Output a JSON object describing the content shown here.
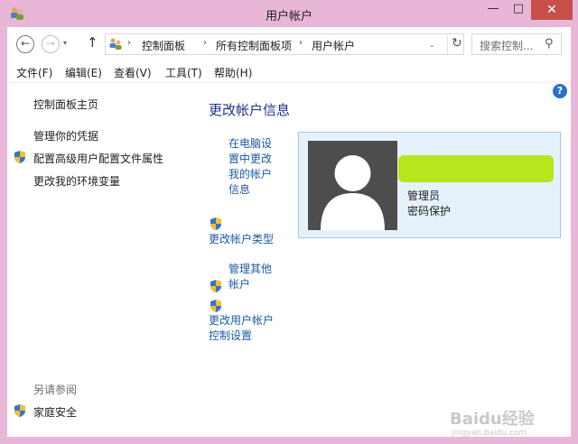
{
  "window": {
    "title": "用户帐户"
  },
  "title_buttons": {
    "minimize": "—",
    "maximize": "□",
    "close": "✕"
  },
  "nav": {
    "back": "←",
    "forward": "→",
    "recent": "▾",
    "up": "↑",
    "refresh": "↻",
    "dropdown": "⌄"
  },
  "address": {
    "crumbs": [
      "控制面板",
      "所有控制面板项",
      "用户帐户"
    ]
  },
  "search": {
    "placeholder": "搜索控制...",
    "icon": "search-icon"
  },
  "menu": [
    "文件(F)",
    "编辑(E)",
    "查看(V)",
    "工具(T)",
    "帮助(H)"
  ],
  "help": {
    "glyph": "?"
  },
  "left_pane": {
    "home_link": "控制面板主页",
    "links": [
      "管理你的凭据",
      "配置高级用户配置文件属性",
      "更改我的环境变量"
    ],
    "see_also_heading": "另请参阅",
    "see_also_links": [
      "家庭安全"
    ]
  },
  "main": {
    "title": "更改帐户信息",
    "tasks": [
      {
        "lines": [
          "在电脑设",
          "置中更改",
          "我的帐户",
          "信息"
        ],
        "shield": false
      },
      {
        "lines": [
          "更改帐户类型"
        ],
        "shield": true
      },
      {
        "lines": [
          "管理其他",
          "帐户"
        ],
        "shield": true
      },
      {
        "lines": [
          "更改用户帐户",
          "控制设置"
        ],
        "shield": true
      }
    ]
  },
  "account": {
    "role": "管理员",
    "password_status": "密码保护"
  },
  "watermark": {
    "text": "Baidu经验",
    "url": "jingyan.baidu.com"
  },
  "colors": {
    "link": "#1a5aa6",
    "title": "#1e3287",
    "border": "#e8b7d8",
    "card_bg": "#e6f2fb",
    "redaction": "#b7e51e"
  }
}
